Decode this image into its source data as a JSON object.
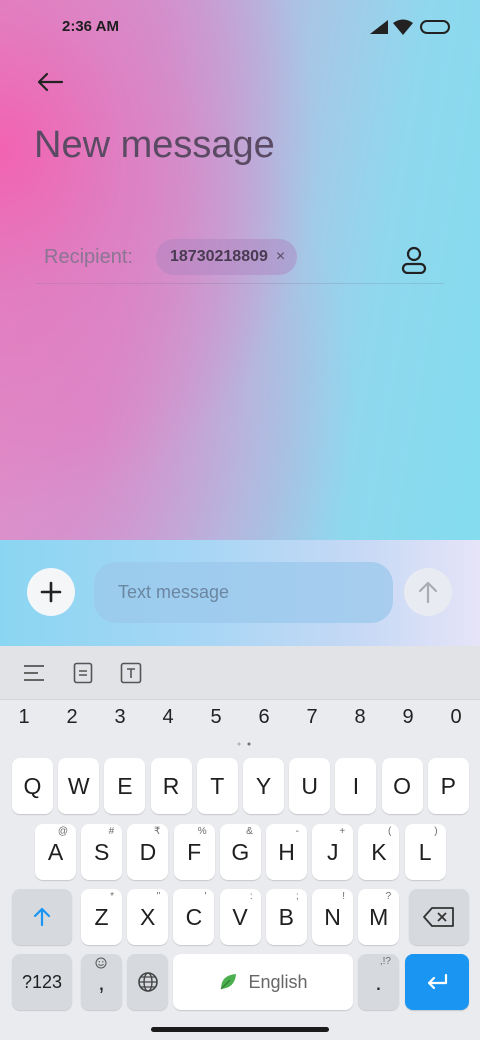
{
  "status_bar": {
    "time": "2:36 AM"
  },
  "header": {
    "title": "New message"
  },
  "recipient": {
    "label": "Recipient:",
    "chip": "18730218809",
    "chip_close": "×"
  },
  "composer": {
    "placeholder": "Text message"
  },
  "keyboard": {
    "numbers": [
      "1",
      "2",
      "3",
      "4",
      "5",
      "6",
      "7",
      "8",
      "9",
      "0"
    ],
    "row1": [
      "Q",
      "W",
      "E",
      "R",
      "T",
      "Y",
      "U",
      "I",
      "O",
      "P"
    ],
    "row2": [
      {
        "k": "A",
        "s": "@"
      },
      {
        "k": "S",
        "s": "#"
      },
      {
        "k": "D",
        "s": "₹"
      },
      {
        "k": "F",
        "s": "%"
      },
      {
        "k": "G",
        "s": "&"
      },
      {
        "k": "H",
        "s": "-"
      },
      {
        "k": "J",
        "s": "+"
      },
      {
        "k": "K",
        "s": "("
      },
      {
        "k": "L",
        "s": ")"
      }
    ],
    "row3": [
      {
        "k": "Z",
        "s": "*"
      },
      {
        "k": "X",
        "s": "\""
      },
      {
        "k": "C",
        "s": "'"
      },
      {
        "k": "V",
        "s": ":"
      },
      {
        "k": "B",
        "s": ";"
      },
      {
        "k": "N",
        "s": "!"
      },
      {
        "k": "M",
        "s": "?"
      }
    ],
    "symbols_key": "?123",
    "comma": ",",
    "space_label": "English",
    "period": ".",
    "period_sub": ",!?"
  },
  "colors": {
    "accent": "#1a96f2",
    "chip_bg": "#b393c7"
  }
}
